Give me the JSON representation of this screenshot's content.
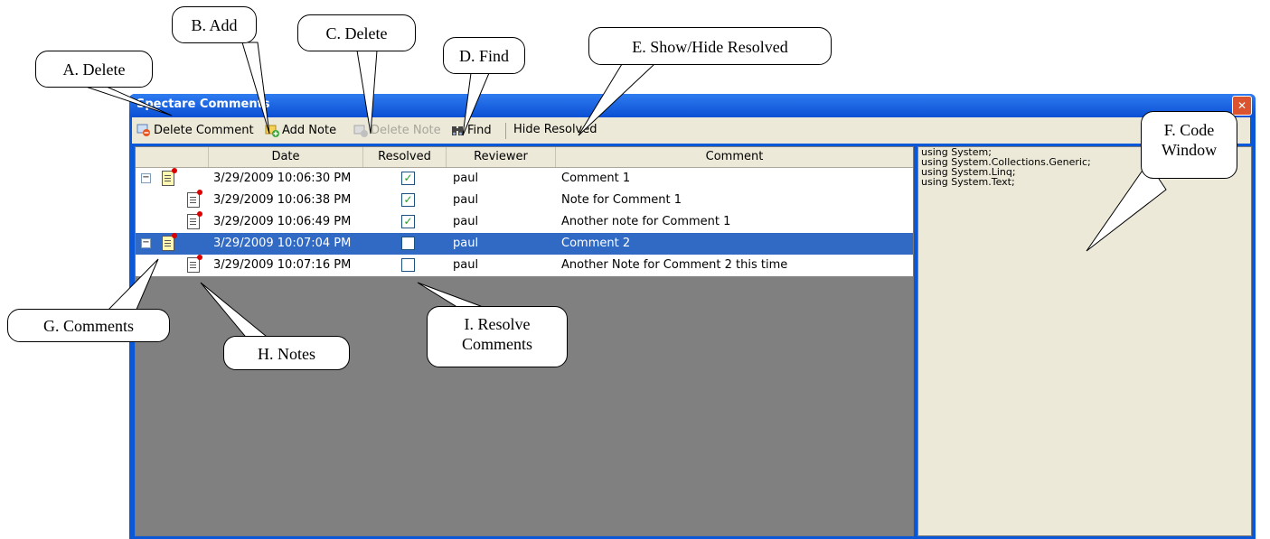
{
  "window": {
    "title": "Spectare Comments",
    "close_glyph": "✕"
  },
  "toolbar": {
    "delete_comment": "Delete Comment",
    "add_note": "Add Note",
    "delete_note": "Delete Note",
    "find": "Find",
    "hide_resolved": "Hide Resolved"
  },
  "grid": {
    "columns": [
      "Date",
      "Resolved",
      "Reviewer",
      "Comment"
    ],
    "rows": [
      {
        "type": "comment",
        "date": "3/29/2009 10:06:30 PM",
        "resolved": true,
        "reviewer": "paul",
        "comment": "Comment 1",
        "selected": false
      },
      {
        "type": "note",
        "date": "3/29/2009 10:06:38 PM",
        "resolved": true,
        "reviewer": "paul",
        "comment": "Note for Comment 1",
        "selected": false
      },
      {
        "type": "note",
        "date": "3/29/2009 10:06:49 PM",
        "resolved": true,
        "reviewer": "paul",
        "comment": "Another note for Comment 1",
        "selected": false
      },
      {
        "type": "comment",
        "date": "3/29/2009 10:07:04 PM",
        "resolved": false,
        "reviewer": "paul",
        "comment": "Comment 2",
        "selected": true
      },
      {
        "type": "note",
        "date": "3/29/2009 10:07:16 PM",
        "resolved": false,
        "reviewer": "paul",
        "comment": "Another Note for Comment 2 this time",
        "selected": false
      }
    ]
  },
  "code_window": {
    "lines": [
      "using System;",
      "using System.Collections.Generic;",
      "using System.Linq;",
      "using System.Text;"
    ]
  },
  "callouts": {
    "a": "A. Delete",
    "b": "B. Add",
    "c": "C. Delete",
    "d": "D. Find",
    "e": "E. Show/Hide Resolved",
    "f_line1": "F. Code",
    "f_line2": "Window",
    "g": "G. Comments",
    "h": "H. Notes",
    "i_line1": "I. Resolve",
    "i_line2": "Comments"
  },
  "colors": {
    "titlebar": "#0a57d8",
    "selection": "#316ac5",
    "grid_background": "#808080",
    "toolbar": "#ece9d8"
  }
}
